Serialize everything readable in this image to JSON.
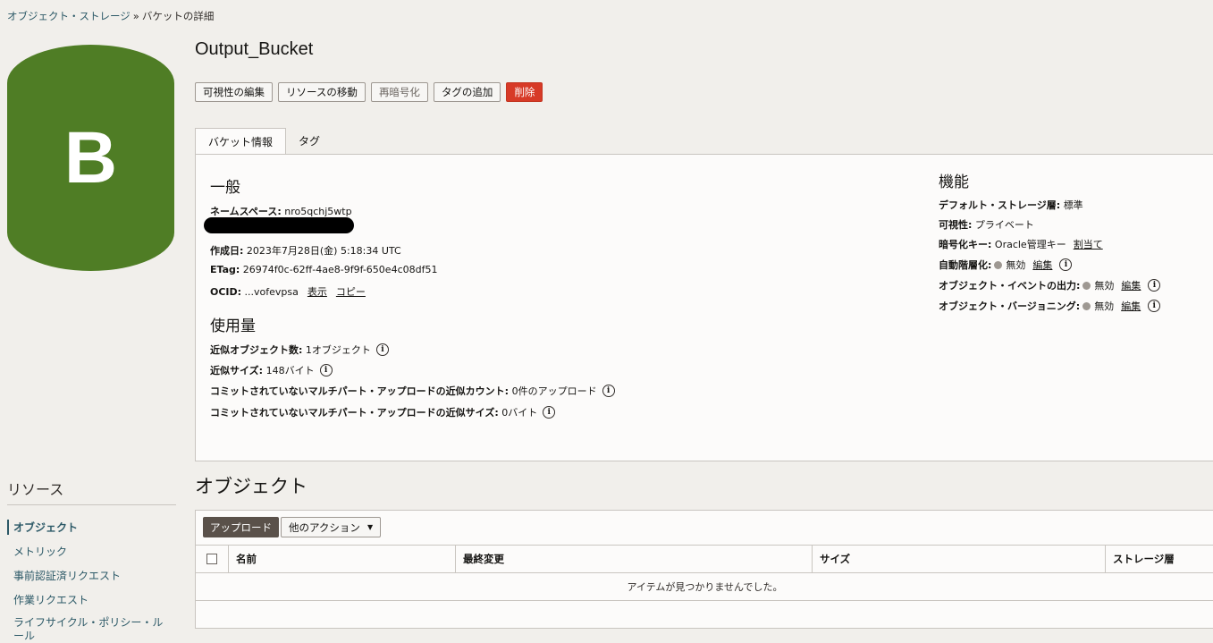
{
  "breadcrumb": {
    "parent": "オブジェクト・ストレージ",
    "separator": "»",
    "current": "バケットの詳細"
  },
  "avatar": {
    "letter": "B",
    "color": "#4f7d25"
  },
  "bucket": {
    "name": "Output_Bucket"
  },
  "actions": {
    "edit_visibility": "可視性の編集",
    "move_resource": "リソースの移動",
    "reencrypt": "再暗号化",
    "add_tag": "タグの追加",
    "delete": "削除"
  },
  "tabs": {
    "bucket_info": "バケット情報",
    "tags": "タグ"
  },
  "general": {
    "heading": "一般",
    "namespace_label": "ネームスペース:",
    "namespace_value": "nro5qchj5wtp",
    "created_label": "作成日:",
    "created_value": "2023年7月28日(金) 5:18:34 UTC",
    "etag_label": "ETag:",
    "etag_value": "26974f0c-62ff-4ae8-9f9f-650e4c08df51",
    "ocid_label": "OCID:",
    "ocid_value": "...vofevpsa",
    "ocid_show": "表示",
    "ocid_copy": "コピー"
  },
  "usage": {
    "heading": "使用量",
    "approx_count_label": "近似オブジェクト数:",
    "approx_count_value": "1オブジェクト",
    "approx_size_label": "近似サイズ:",
    "approx_size_value": "148バイト",
    "multipart_count_label": "コミットされていないマルチパート・アップロードの近似カウント:",
    "multipart_count_value": "0件のアップロード",
    "multipart_size_label": "コミットされていないマルチパート・アップロードの近似サイズ:",
    "multipart_size_value": "0バイト"
  },
  "features": {
    "heading": "機能",
    "default_tier_label": "デフォルト・ストレージ層:",
    "default_tier_value": "標準",
    "visibility_label": "可視性:",
    "visibility_value": "プライベート",
    "encryption_label": "暗号化キー:",
    "encryption_value": "Oracle管理キー",
    "encryption_assign": "割当て",
    "auto_tiering_label": "自動階層化:",
    "auto_tiering_value": "無効",
    "auto_tiering_edit": "編集",
    "events_label": "オブジェクト・イベントの出力:",
    "events_value": "無効",
    "events_edit": "編集",
    "versioning_label": "オブジェクト・バージョニング:",
    "versioning_value": "無効",
    "versioning_edit": "編集"
  },
  "resources": {
    "heading": "リソース",
    "items": [
      "オブジェクト",
      "メトリック",
      "事前認証済リクエスト",
      "作業リクエスト",
      "ライフサイクル・ポリシー・ルール"
    ]
  },
  "objects": {
    "heading": "オブジェクト",
    "upload": "アップロード",
    "more_actions": "他のアクション",
    "columns": [
      "名前",
      "最終変更",
      "サイズ",
      "ストレージ層"
    ],
    "empty": "アイテムが見つかりませんでした。"
  }
}
